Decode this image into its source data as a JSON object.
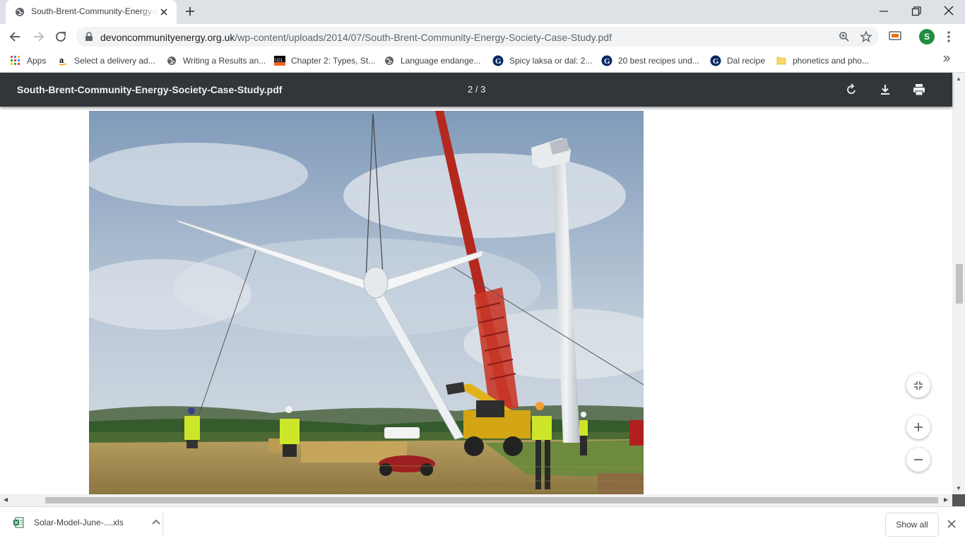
{
  "tab": {
    "title": "South-Brent-Community-Energy-Society-Case-Study.pdf",
    "favicon": "globe-icon"
  },
  "address_bar": {
    "domain": "devoncommunityenergy.org.uk",
    "path": "/wp-content/uploads/2014/07/South-Brent-Community-Energy-Society-Case-Study.pdf"
  },
  "profile": {
    "initial": "S",
    "color": "#1e8e3e"
  },
  "bookmarks": [
    {
      "label": "Apps",
      "icon": "apps-grid-icon"
    },
    {
      "label": "Select a delivery ad...",
      "icon": "amazon-icon"
    },
    {
      "label": "Writing a Results an...",
      "icon": "globe-icon"
    },
    {
      "label": "Chapter 2: Types, St...",
      "icon": "ucl-icon"
    },
    {
      "label": "Language endange...",
      "icon": "globe-icon"
    },
    {
      "label": "Spicy laksa or dal: 2...",
      "icon": "guardian-icon"
    },
    {
      "label": "20 best recipes und...",
      "icon": "guardian-icon"
    },
    {
      "label": "Dal recipe",
      "icon": "guardian-icon"
    },
    {
      "label": "phonetics and pho...",
      "icon": "folder-icon"
    }
  ],
  "pdf": {
    "filename": "South-Brent-Community-Energy-Society-Case-Study.pdf",
    "page_indicator": "2 / 3",
    "bar_color": "#323639"
  },
  "download": {
    "filename": "Solar-Model-June-....xls",
    "show_all": "Show all"
  }
}
